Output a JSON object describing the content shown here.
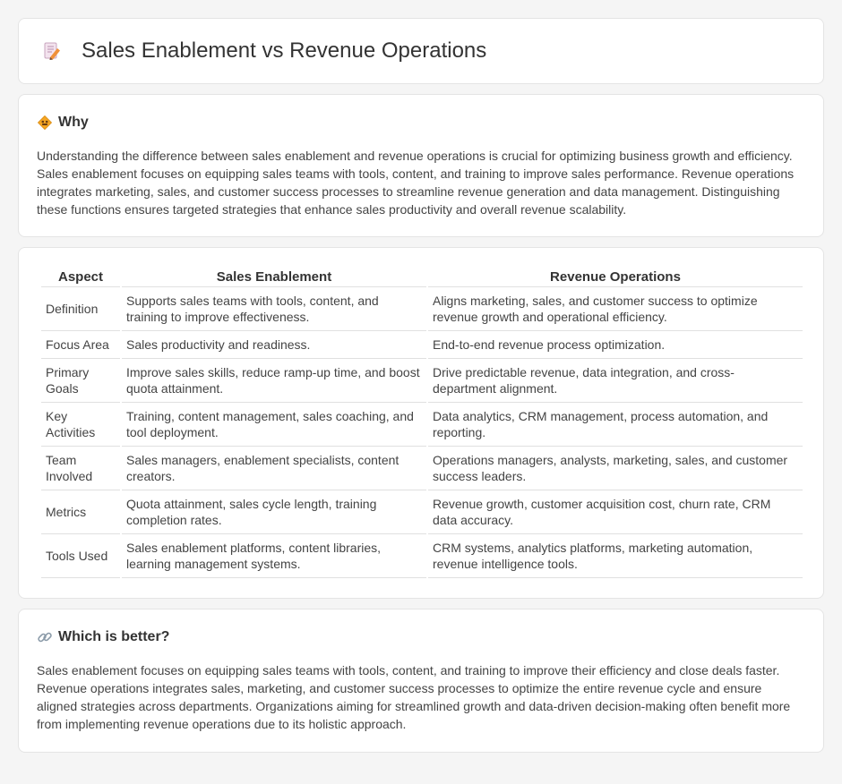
{
  "header": {
    "title": "Sales Enablement vs Revenue Operations",
    "icon": "document-pencil-icon"
  },
  "why": {
    "title": "Why",
    "icon": "diamond-sign-icon",
    "text": "Understanding the difference between sales enablement and revenue operations is crucial for optimizing business growth and efficiency. Sales enablement focuses on equipping sales teams with tools, content, and training to improve sales performance. Revenue operations integrates marketing, sales, and customer success processes to streamline revenue generation and data management. Distinguishing these functions ensures targeted strategies that enhance sales productivity and overall revenue scalability."
  },
  "table": {
    "headers": [
      "Aspect",
      "Sales Enablement",
      "Revenue Operations"
    ],
    "rows": [
      {
        "aspect": "Definition",
        "se": "Supports sales teams with tools, content, and training to improve effectiveness.",
        "ro": "Aligns marketing, sales, and customer success to optimize revenue growth and operational efficiency."
      },
      {
        "aspect": "Focus Area",
        "se": "Sales productivity and readiness.",
        "ro": "End-to-end revenue process optimization."
      },
      {
        "aspect": "Primary Goals",
        "se": "Improve sales skills, reduce ramp-up time, and boost quota attainment.",
        "ro": "Drive predictable revenue, data integration, and cross-department alignment."
      },
      {
        "aspect": "Key Activities",
        "se": "Training, content management, sales coaching, and tool deployment.",
        "ro": "Data analytics, CRM management, process automation, and reporting."
      },
      {
        "aspect": "Team Involved",
        "se": "Sales managers, enablement specialists, content creators.",
        "ro": "Operations managers, analysts, marketing, sales, and customer success leaders."
      },
      {
        "aspect": "Metrics",
        "se": "Quota attainment, sales cycle length, training completion rates.",
        "ro": "Revenue growth, customer acquisition cost, churn rate, CRM data accuracy."
      },
      {
        "aspect": "Tools Used",
        "se": "Sales enablement platforms, content libraries, learning management systems.",
        "ro": "CRM systems, analytics platforms, marketing automation, revenue intelligence tools."
      }
    ]
  },
  "which": {
    "title": "Which is better?",
    "icon": "link-icon",
    "text": "Sales enablement focuses on equipping sales teams with tools, content, and training to improve their efficiency and close deals faster. Revenue operations integrates sales, marketing, and customer success processes to optimize the entire revenue cycle and ensure aligned strategies across departments. Organizations aiming for streamlined growth and data-driven decision-making often benefit more from implementing revenue operations due to its holistic approach."
  }
}
